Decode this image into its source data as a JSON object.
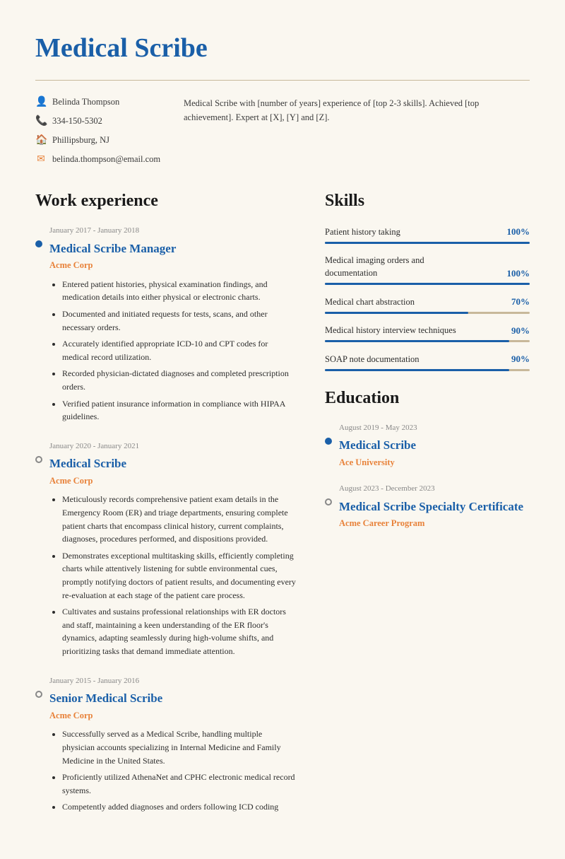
{
  "header": {
    "title": "Medical Scribe",
    "contact": {
      "name": "Belinda Thompson",
      "phone": "334-150-5302",
      "location": "Phillipsburg, NJ",
      "email": "belinda.thompson@email.com"
    },
    "summary": "Medical Scribe with [number of years] experience of [top 2-3 skills]. Achieved [top achievement]. Expert at [X], [Y] and [Z]."
  },
  "work_experience": {
    "section_title": "Work experience",
    "jobs": [
      {
        "dates": "January 2017 - January 2018",
        "title": "Medical Scribe Manager",
        "company": "Acme Corp",
        "bullet_type": "filled",
        "bullets": [
          "Entered patient histories, physical examination findings, and medication details into either physical or electronic charts.",
          "Documented and initiated requests for tests, scans, and other necessary orders.",
          "Accurately identified appropriate ICD-10 and CPT codes for medical record utilization.",
          "Recorded physician-dictated diagnoses and completed prescription orders.",
          "Verified patient insurance information in compliance with HIPAA guidelines."
        ]
      },
      {
        "dates": "January 2020 - January 2021",
        "title": "Medical Scribe",
        "company": "Acme Corp",
        "bullet_type": "outline",
        "bullets": [
          "Meticulously records comprehensive patient exam details in the Emergency Room (ER) and triage departments, ensuring complete patient charts that encompass clinical history, current complaints, diagnoses, procedures performed, and dispositions provided.",
          "Demonstrates exceptional multitasking skills, efficiently completing charts while attentively listening for subtle environmental cues, promptly notifying doctors of patient results, and documenting every re-evaluation at each stage of the patient care process.",
          "Cultivates and sustains professional relationships with ER doctors and staff, maintaining a keen understanding of the ER floor's dynamics, adapting seamlessly during high-volume shifts, and prioritizing tasks that demand immediate attention."
        ]
      },
      {
        "dates": "January 2015 - January 2016",
        "title": "Senior Medical Scribe",
        "company": "Acme Corp",
        "bullet_type": "outline",
        "bullets": [
          "Successfully served as a Medical Scribe, handling multiple physician accounts specializing in Internal Medicine and Family Medicine in the United States.",
          "Proficiently utilized AthenaNet and CPHC electronic medical record systems.",
          "Competently added diagnoses and orders following ICD coding"
        ]
      }
    ]
  },
  "skills": {
    "section_title": "Skills",
    "items": [
      {
        "label": "Patient history taking",
        "pct": 100
      },
      {
        "label": "Medical imaging orders and documentation",
        "pct": 100
      },
      {
        "label": "Medical chart abstraction",
        "pct": 70
      },
      {
        "label": "Medical history interview techniques",
        "pct": 90
      },
      {
        "label": "SOAP note documentation",
        "pct": 90
      }
    ]
  },
  "education": {
    "section_title": "Education",
    "items": [
      {
        "dates": "August 2019 - May 2023",
        "title": "Medical Scribe",
        "institution": "Ace University",
        "bullet_type": "filled"
      },
      {
        "dates": "August 2023 - December 2023",
        "title": "Medical Scribe Specialty Certificate",
        "institution": "Acme Career Program",
        "bullet_type": "outline"
      }
    ]
  }
}
